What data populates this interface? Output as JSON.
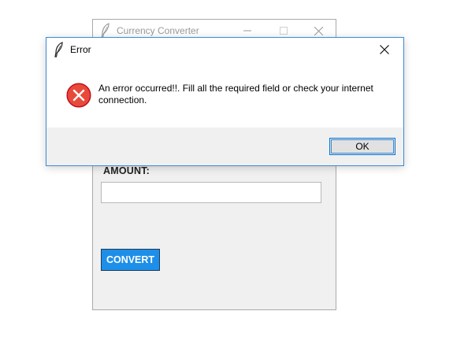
{
  "main_window": {
    "title": "Currency Converter",
    "icon": "tk-feather-icon",
    "controls": [
      "minimize-icon",
      "maximize-icon",
      "close-icon"
    ],
    "amount_label": "AMOUNT:",
    "amount_value": "",
    "convert_label": "CONVERT"
  },
  "dialog": {
    "title": "Error",
    "icon": "tk-feather-icon",
    "message_icon": "error-icon",
    "message": "An error occurred!!. Fill all the required field or check your internet connection.",
    "ok_label": "OK"
  },
  "colors": {
    "convert_button": "#1e8fe8",
    "dialog_border": "#3c8ad8",
    "error_icon": "#e81123",
    "window_bg": "#f0f0f0"
  }
}
